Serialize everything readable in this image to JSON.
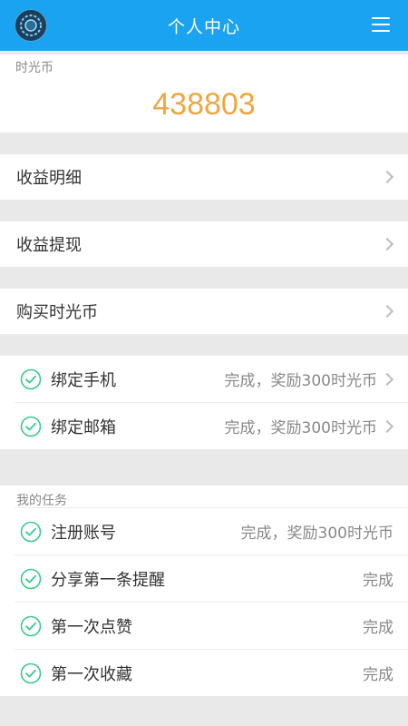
{
  "header": {
    "title": "个人中心"
  },
  "coins": {
    "label": "时光币",
    "value": "438803"
  },
  "menu": [
    {
      "label": "收益明细"
    },
    {
      "label": "收益提现"
    },
    {
      "label": "购买时光币"
    }
  ],
  "bindings": [
    {
      "label": "绑定手机",
      "status": "完成，奖励300时光币"
    },
    {
      "label": "绑定邮箱",
      "status": "完成，奖励300时光币"
    }
  ],
  "tasks": {
    "title": "我的任务",
    "items": [
      {
        "label": "注册账号",
        "status": "完成，奖励300时光币"
      },
      {
        "label": "分享第一条提醒",
        "status": "完成"
      },
      {
        "label": "第一次点赞",
        "status": "完成"
      },
      {
        "label": "第一次收藏",
        "status": "完成"
      }
    ]
  },
  "colors": {
    "header": "#1aa3f0",
    "accent": "#f0a640",
    "check": "#3cc88c"
  }
}
